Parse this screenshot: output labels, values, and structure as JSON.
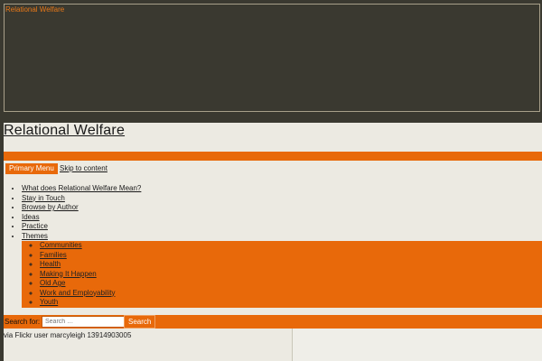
{
  "header_image": {
    "alt_text": "Relational Welfare"
  },
  "site": {
    "title": "Relational Welfare"
  },
  "nav": {
    "toggle_label": "Primary Menu",
    "skip_label": "Skip to content",
    "items": [
      "What does Relational Welfare Mean?",
      "Stay in Touch",
      "Browse by Author",
      "Ideas",
      "Practice",
      "Themes"
    ],
    "theme_items": [
      "Communities",
      "Families",
      "Health",
      "Making It Happen",
      "Old Age",
      "Work and Employability",
      "Youth"
    ]
  },
  "search": {
    "label": "Search for:",
    "placeholder": "Search …",
    "button": "Search"
  },
  "credit": "via Flickr user marcyleigh 13914903005",
  "colors": {
    "accent": "#e8690a",
    "page_bg": "#eceae2",
    "outer_bg": "#3a3930"
  }
}
